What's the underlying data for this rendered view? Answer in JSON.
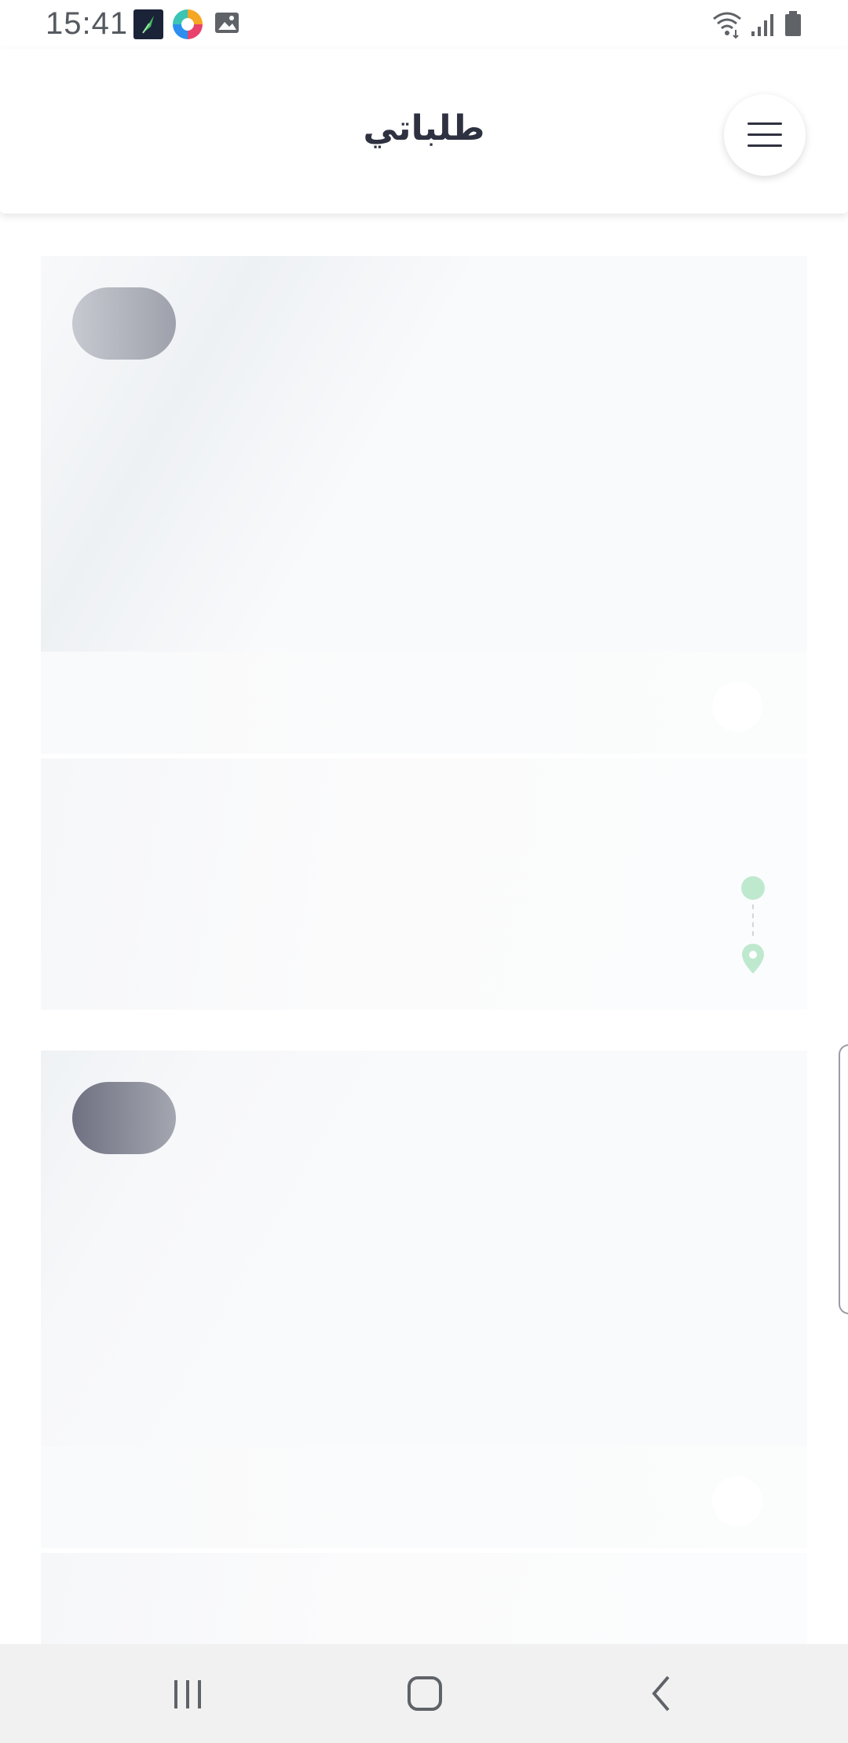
{
  "status_bar": {
    "time": "15:41",
    "notification_icons": [
      "feather-app-icon",
      "colorful-app-icon",
      "gallery-icon"
    ],
    "system_icons": [
      "wifi-icon",
      "signal-icon",
      "battery-icon"
    ]
  },
  "header": {
    "title": "طلباتي",
    "menu_icon": "hamburger-menu-icon"
  },
  "cards": [
    {
      "state": "loading",
      "route_icons": [
        "origin-dot-icon",
        "destination-pin-icon"
      ]
    },
    {
      "state": "loading"
    }
  ],
  "colors": {
    "title": "#2e3140",
    "route_accent": "#bfe9cf",
    "skeleton_base": "#f9fafc"
  },
  "nav_bar": {
    "buttons": [
      "recents-icon",
      "home-icon",
      "back-icon"
    ]
  }
}
